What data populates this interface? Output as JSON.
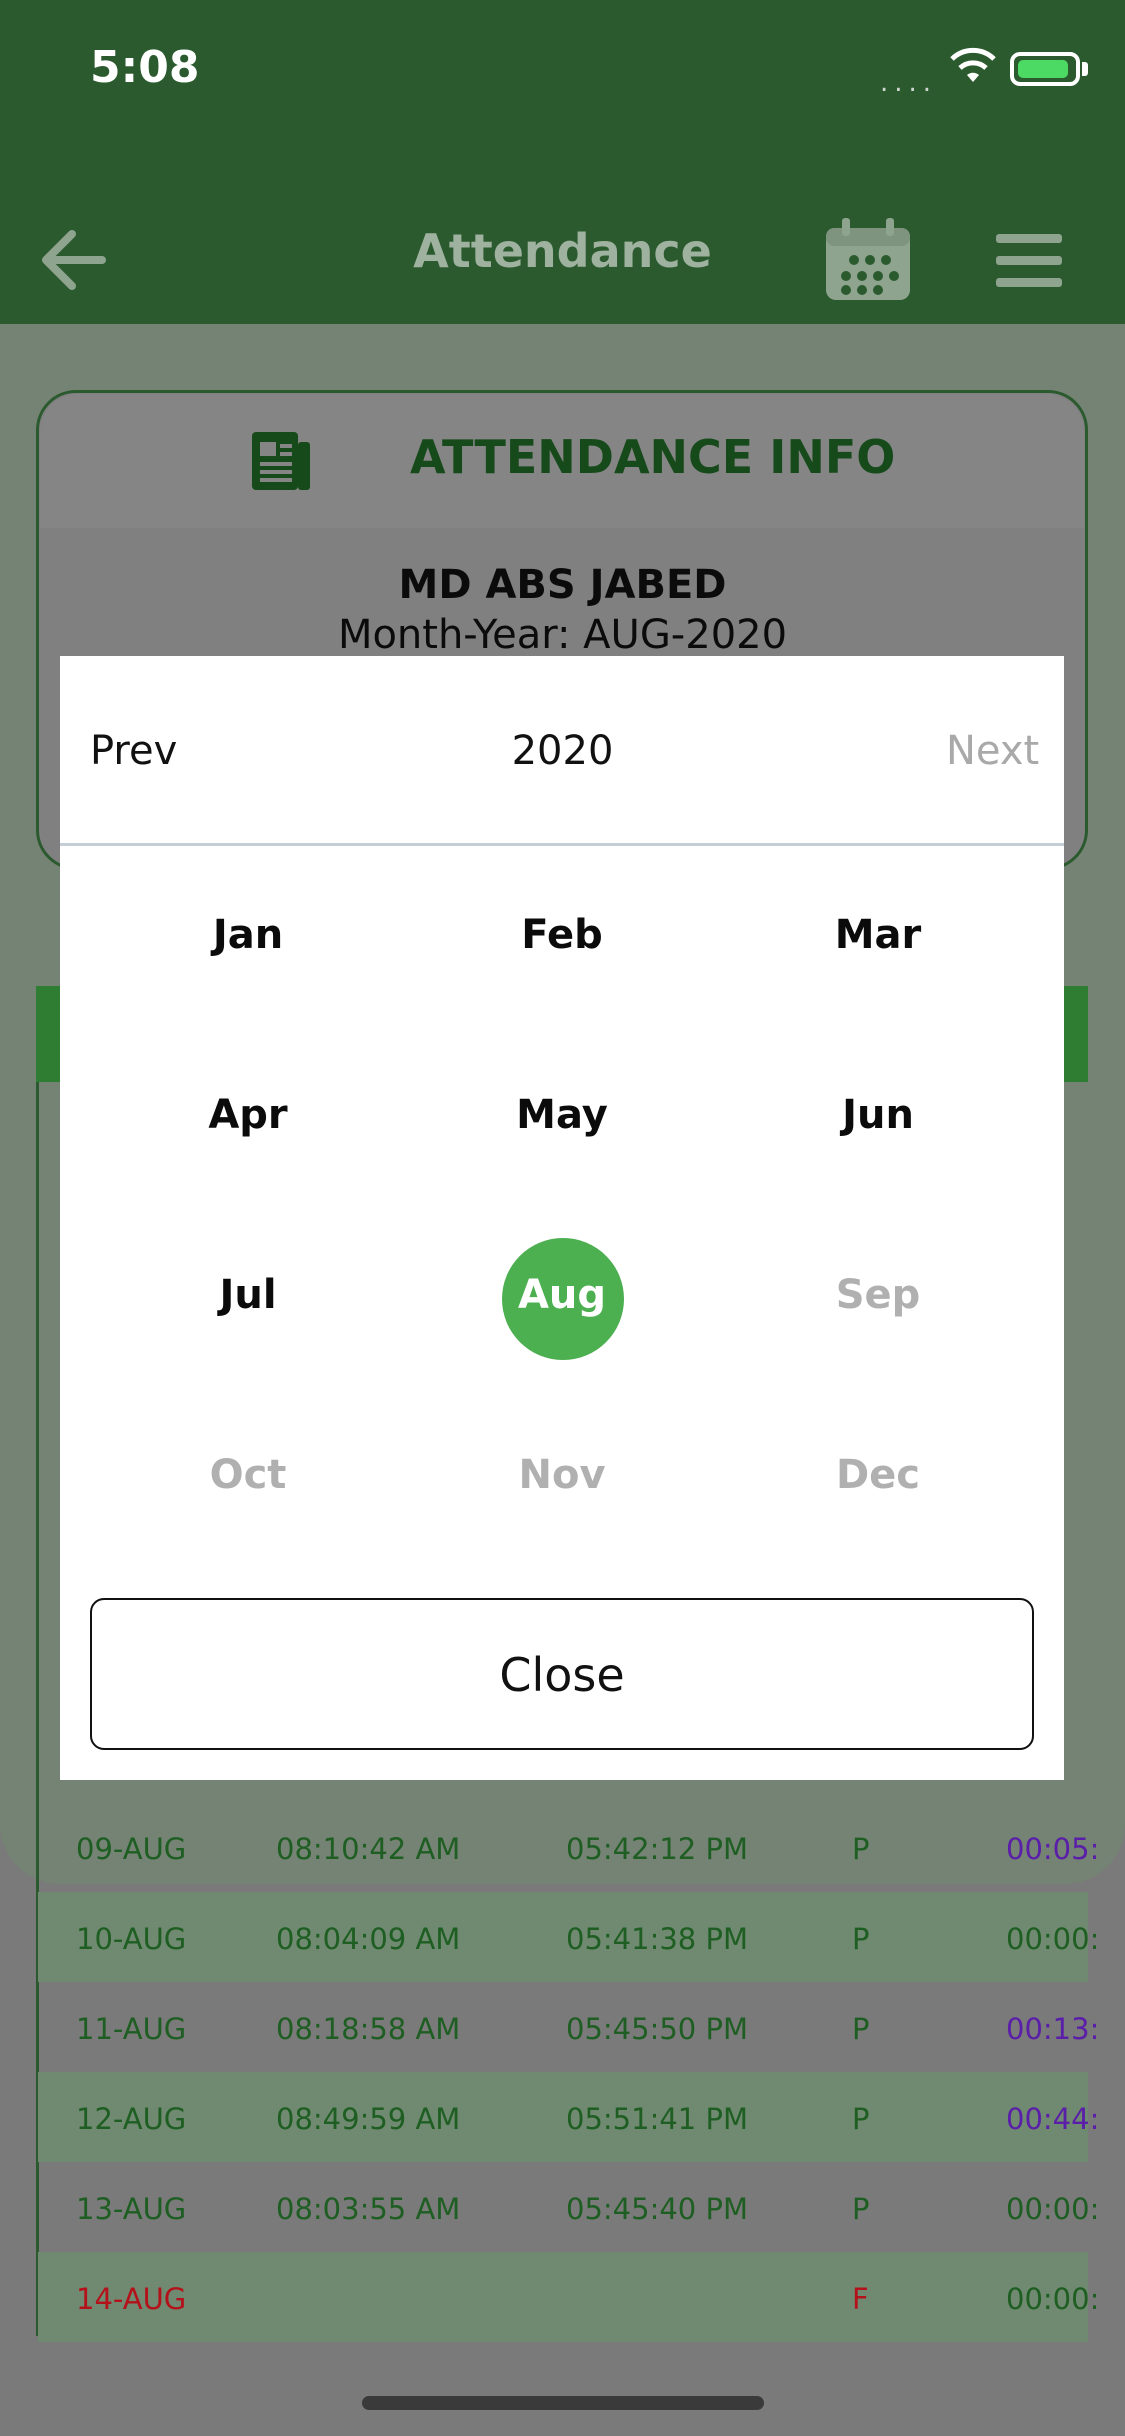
{
  "status": {
    "time": "5:08",
    "signal": "....",
    "wifi_icon": "wifi-icon",
    "battery_icon": "battery-charging-icon"
  },
  "header": {
    "title": "Attendance",
    "back_icon": "arrow-left-icon",
    "calendar_icon": "calendar-icon",
    "menu_icon": "hamburger-menu-icon"
  },
  "info": {
    "title": "ATTENDANCE INFO",
    "name": "MD ABS JABED",
    "month_year": "Month-Year: AUG-2020"
  },
  "picker": {
    "prev": "Prev",
    "year": "2020",
    "next": "Next",
    "months": [
      "Jan",
      "Feb",
      "Mar",
      "Apr",
      "May",
      "Jun",
      "Jul",
      "Aug",
      "Sep",
      "Oct",
      "Nov",
      "Dec"
    ],
    "selected": "Aug",
    "close": "Close"
  },
  "rows": [
    {
      "date": "09-AUG",
      "in": "08:10:42 AM",
      "out": "05:42:12 PM",
      "status": "P",
      "late": "00:05:"
    },
    {
      "date": "10-AUG",
      "in": "08:04:09 AM",
      "out": "05:41:38 PM",
      "status": "P",
      "late": "00:00:"
    },
    {
      "date": "11-AUG",
      "in": "08:18:58 AM",
      "out": "05:45:50 PM",
      "status": "P",
      "late": "00:13:"
    },
    {
      "date": "12-AUG",
      "in": "08:49:59 AM",
      "out": "05:51:41 PM",
      "status": "P",
      "late": "00:44:"
    },
    {
      "date": "13-AUG",
      "in": "08:03:55 AM",
      "out": "05:45:40 PM",
      "status": "P",
      "late": "00:00:"
    },
    {
      "date": "14-AUG",
      "in": "",
      "out": "",
      "status": "F",
      "late": "00:00:"
    }
  ],
  "colors": {
    "header_bg": "#2a5a2e",
    "accent": "#4caf50",
    "late_purple": "#5a1ea8",
    "absent_red": "#b3121b"
  }
}
